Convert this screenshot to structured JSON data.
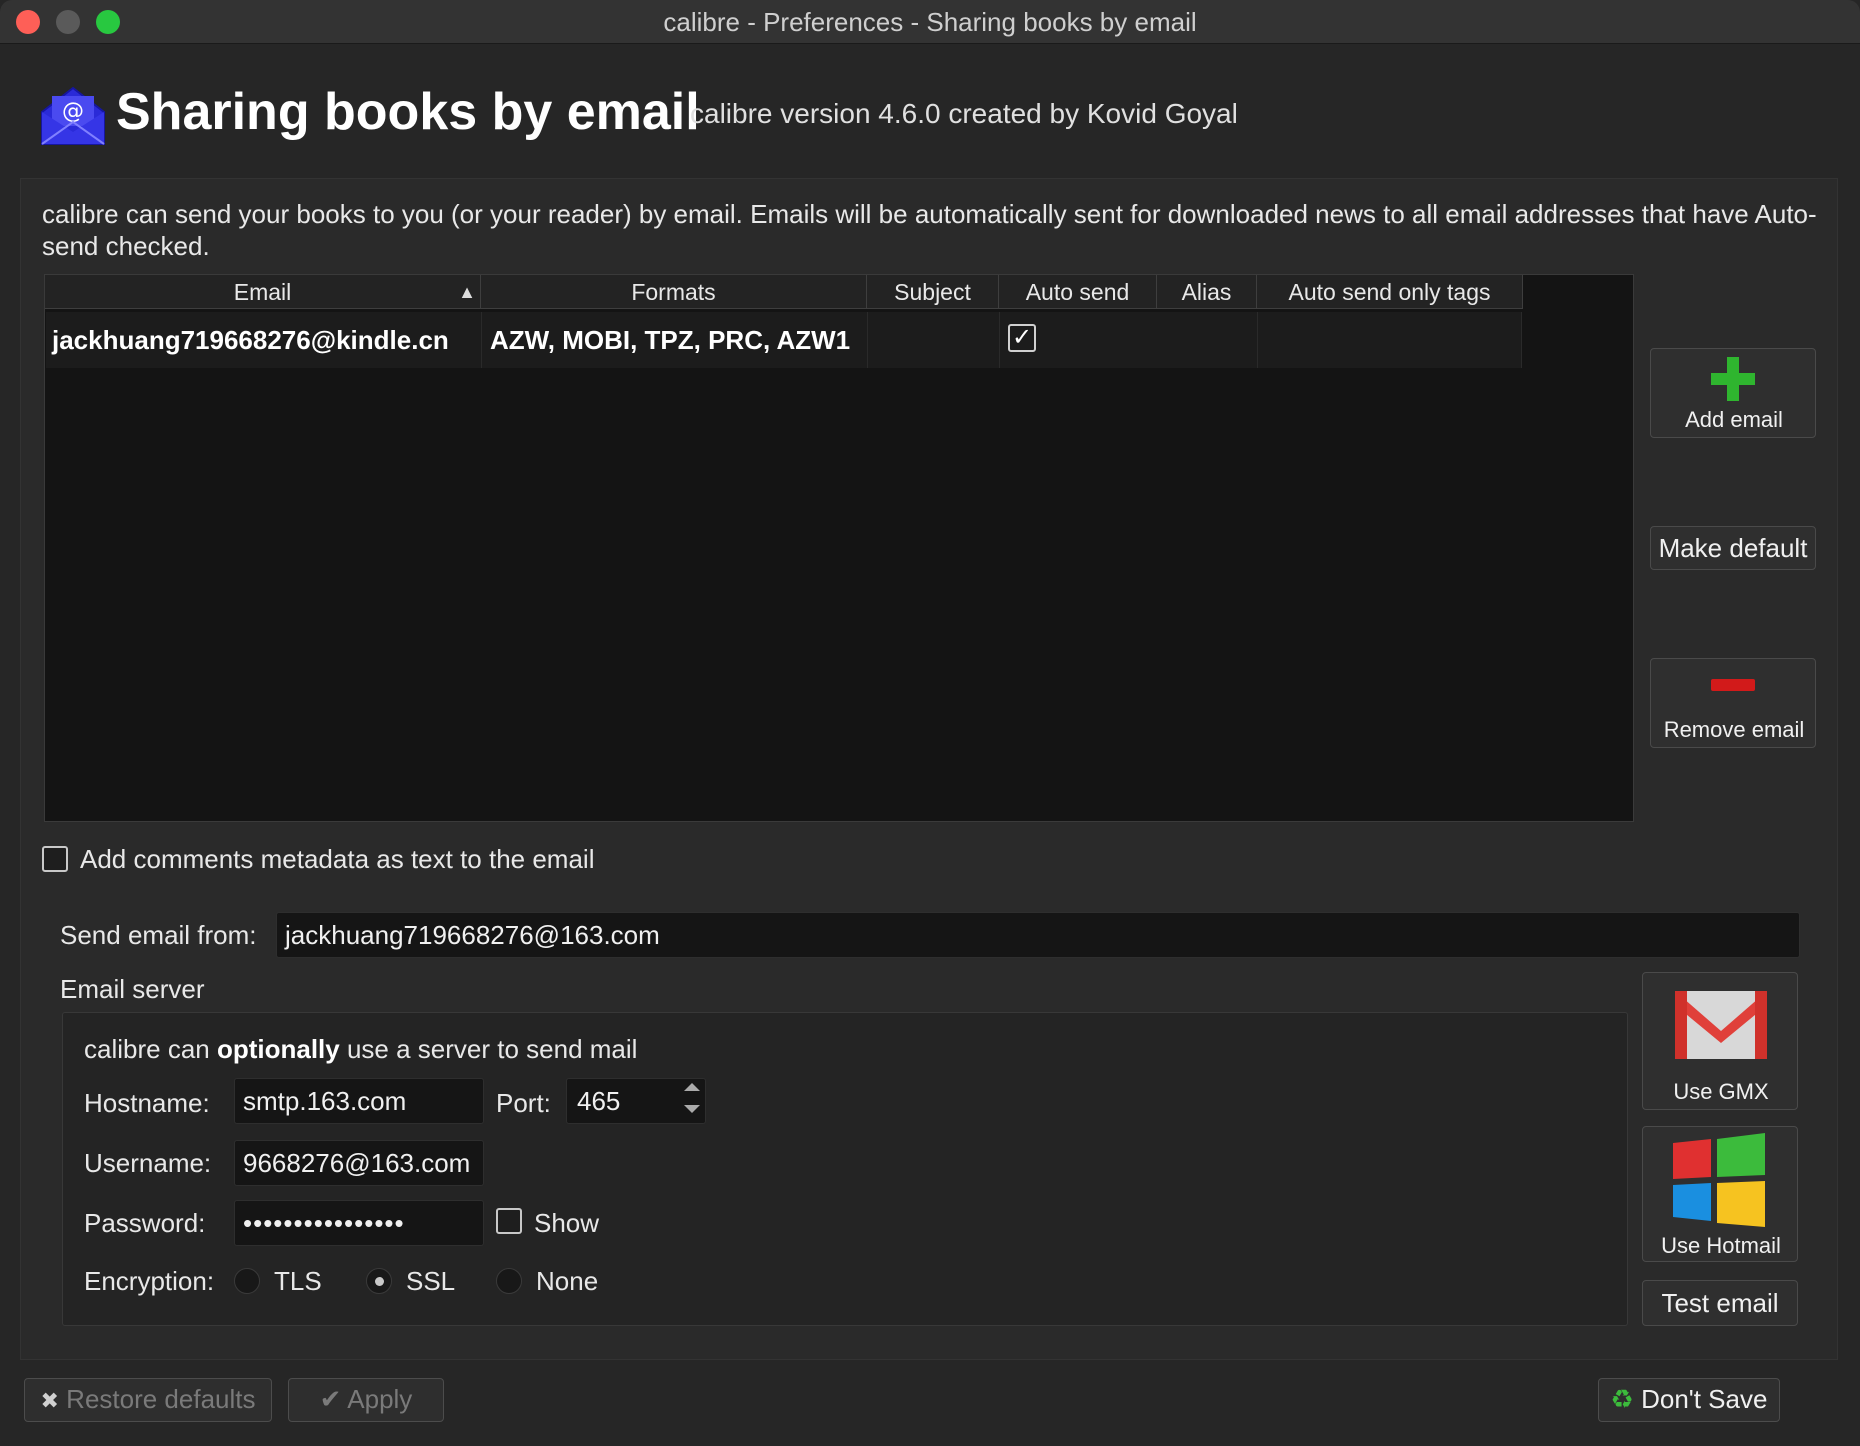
{
  "window": {
    "title": "calibre - Preferences - Sharing books by email"
  },
  "header": {
    "title": "Sharing books by email",
    "subtitle": "calibre version 4.6.0 created by Kovid Goyal"
  },
  "description": "calibre can send your books to you (or your reader) by email. Emails will be automatically sent for downloaded news to all email addresses that have Auto-send checked.",
  "table": {
    "columns": [
      "Email",
      "Formats",
      "Subject",
      "Auto send",
      "Alias",
      "Auto send only tags"
    ],
    "rows": [
      {
        "email": "jackhuang719668276@kindle.cn",
        "formats": "AZW, MOBI, TPZ, PRC, AZW1",
        "subject": "",
        "auto_send": true,
        "alias": "",
        "tags": ""
      }
    ]
  },
  "side_buttons": {
    "add": "Add email",
    "make_default": "Make default",
    "remove": "Remove email"
  },
  "comments_checkbox": "Add comments metadata as text to the email",
  "send_from": {
    "label": "Send email from:",
    "value": "jackhuang719668276@163.com"
  },
  "server": {
    "section_label": "Email server",
    "intro_pre": "calibre can ",
    "intro_bold": "optionally",
    "intro_post": " use a server to send mail",
    "hostname_label": "Hostname:",
    "hostname": "smtp.163.com",
    "port_label": "Port:",
    "port": "465",
    "username_label": "Username:",
    "username": "9668276@163.com",
    "password_label": "Password:",
    "password_mask": "••••••••••••••••",
    "show_label": "Show",
    "encryption_label": "Encryption:",
    "encryption_options": [
      "TLS",
      "SSL",
      "None"
    ],
    "encryption_selected": "SSL"
  },
  "provider_buttons": {
    "gmx": "Use GMX",
    "hotmail": "Use Hotmail",
    "test": "Test email"
  },
  "bottom": {
    "restore": "Restore defaults",
    "apply": "Apply",
    "dont_save": "Don't Save"
  },
  "colors": {
    "close": "#fe5f57",
    "minimize": "#5a5a5a",
    "zoom": "#28c840",
    "background": "#262626"
  }
}
